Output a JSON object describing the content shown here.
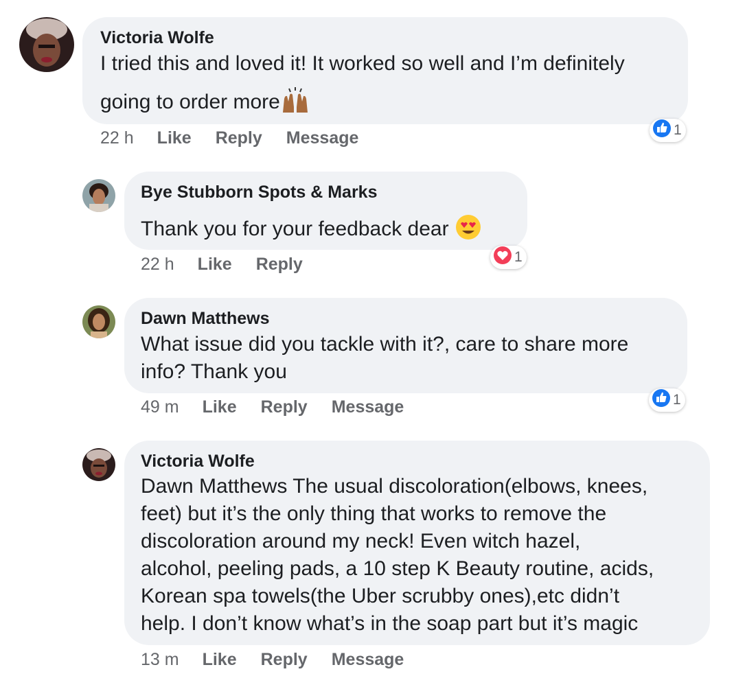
{
  "comments": [
    {
      "author": "Victoria Wolfe",
      "lines": [
        "I tried this and loved it! It worked so well and I’m definitely",
        "going to order more"
      ],
      "emoji": "raising-hands",
      "time": "22 h",
      "actions": [
        "Like",
        "Reply",
        "Message"
      ],
      "reaction": {
        "type": "like",
        "count": "1",
        "color": "#1877f2"
      }
    },
    {
      "author": "Bye Stubborn Spots & Marks",
      "lines": [
        "Thank you for your feedback dear"
      ],
      "emoji": "heart-eyes",
      "time": "22 h",
      "actions": [
        "Like",
        "Reply"
      ],
      "reaction": {
        "type": "love",
        "count": "1",
        "color": "#f33e58"
      }
    },
    {
      "author": "Dawn Matthews",
      "lines": [
        "What issue did you tackle with it?, care to share more",
        "info? Thank you"
      ],
      "time": "49 m",
      "actions": [
        "Like",
        "Reply",
        "Message"
      ],
      "reaction": {
        "type": "like",
        "count": "1",
        "color": "#1877f2"
      }
    },
    {
      "author": "Victoria Wolfe",
      "lines": [
        "Dawn Matthews The usual discoloration(elbows, knees,",
        "feet) but it’s the only thing that works to remove the",
        "discoloration around my neck! Even witch hazel,",
        "alcohol, peeling pads, a 10 step K Beauty routine, acids,",
        "Korean spa towels(the Uber scrubby ones),etc didn’t",
        "help. I don’t know what’s in the soap part but it’s magic"
      ],
      "time": "13 m",
      "actions": [
        "Like",
        "Reply",
        "Message"
      ]
    }
  ],
  "colors": {
    "bubble": "#f0f2f5",
    "meta": "#65676b",
    "text": "#1c1e21"
  }
}
